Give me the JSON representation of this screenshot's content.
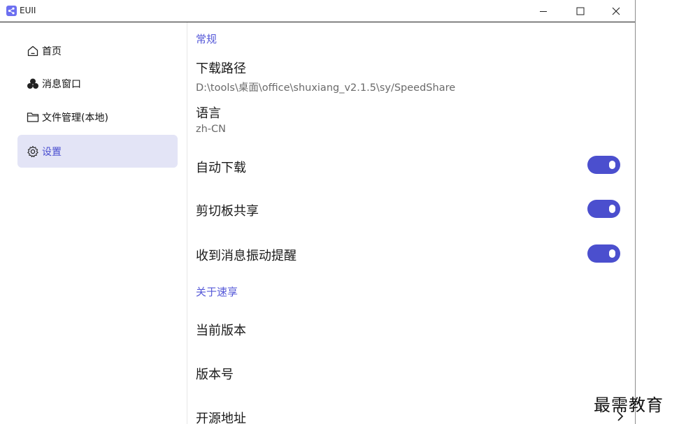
{
  "window": {
    "title": "EUII",
    "controls": {
      "minimize": "minimize-icon",
      "maximize": "maximize-icon",
      "close": "close-icon"
    }
  },
  "sidebar": {
    "items": [
      {
        "label": "首页",
        "icon": "home-icon",
        "active": false
      },
      {
        "label": "消息窗口",
        "icon": "message-icon",
        "active": false
      },
      {
        "label": "文件管理(本地)",
        "icon": "folder-icon",
        "active": false
      },
      {
        "label": "设置",
        "icon": "gear-icon",
        "active": true
      }
    ]
  },
  "settings": {
    "general_header": "常规",
    "download_path": {
      "title": "下载路径",
      "value": "D:\\tools\\桌面\\office\\shuxiang_v2.1.5\\sy/SpeedShare"
    },
    "language": {
      "title": "语言",
      "value": "zh-CN"
    },
    "auto_download": {
      "title": "自动下载",
      "enabled": true
    },
    "clipboard_share": {
      "title": "剪切板共享",
      "enabled": true
    },
    "vibrate_on_message": {
      "title": "收到消息振动提醒",
      "enabled": true
    },
    "about_header": "关于速享",
    "current_version": {
      "title": "当前版本"
    },
    "version_number": {
      "title": "版本号"
    },
    "open_source": {
      "title": "开源地址",
      "icon": "chevron-right-icon"
    }
  },
  "watermark": "最需教育",
  "colors": {
    "accent": "#4b4fce",
    "active_bg": "#e3e4f6",
    "section_header": "#5558d8"
  }
}
